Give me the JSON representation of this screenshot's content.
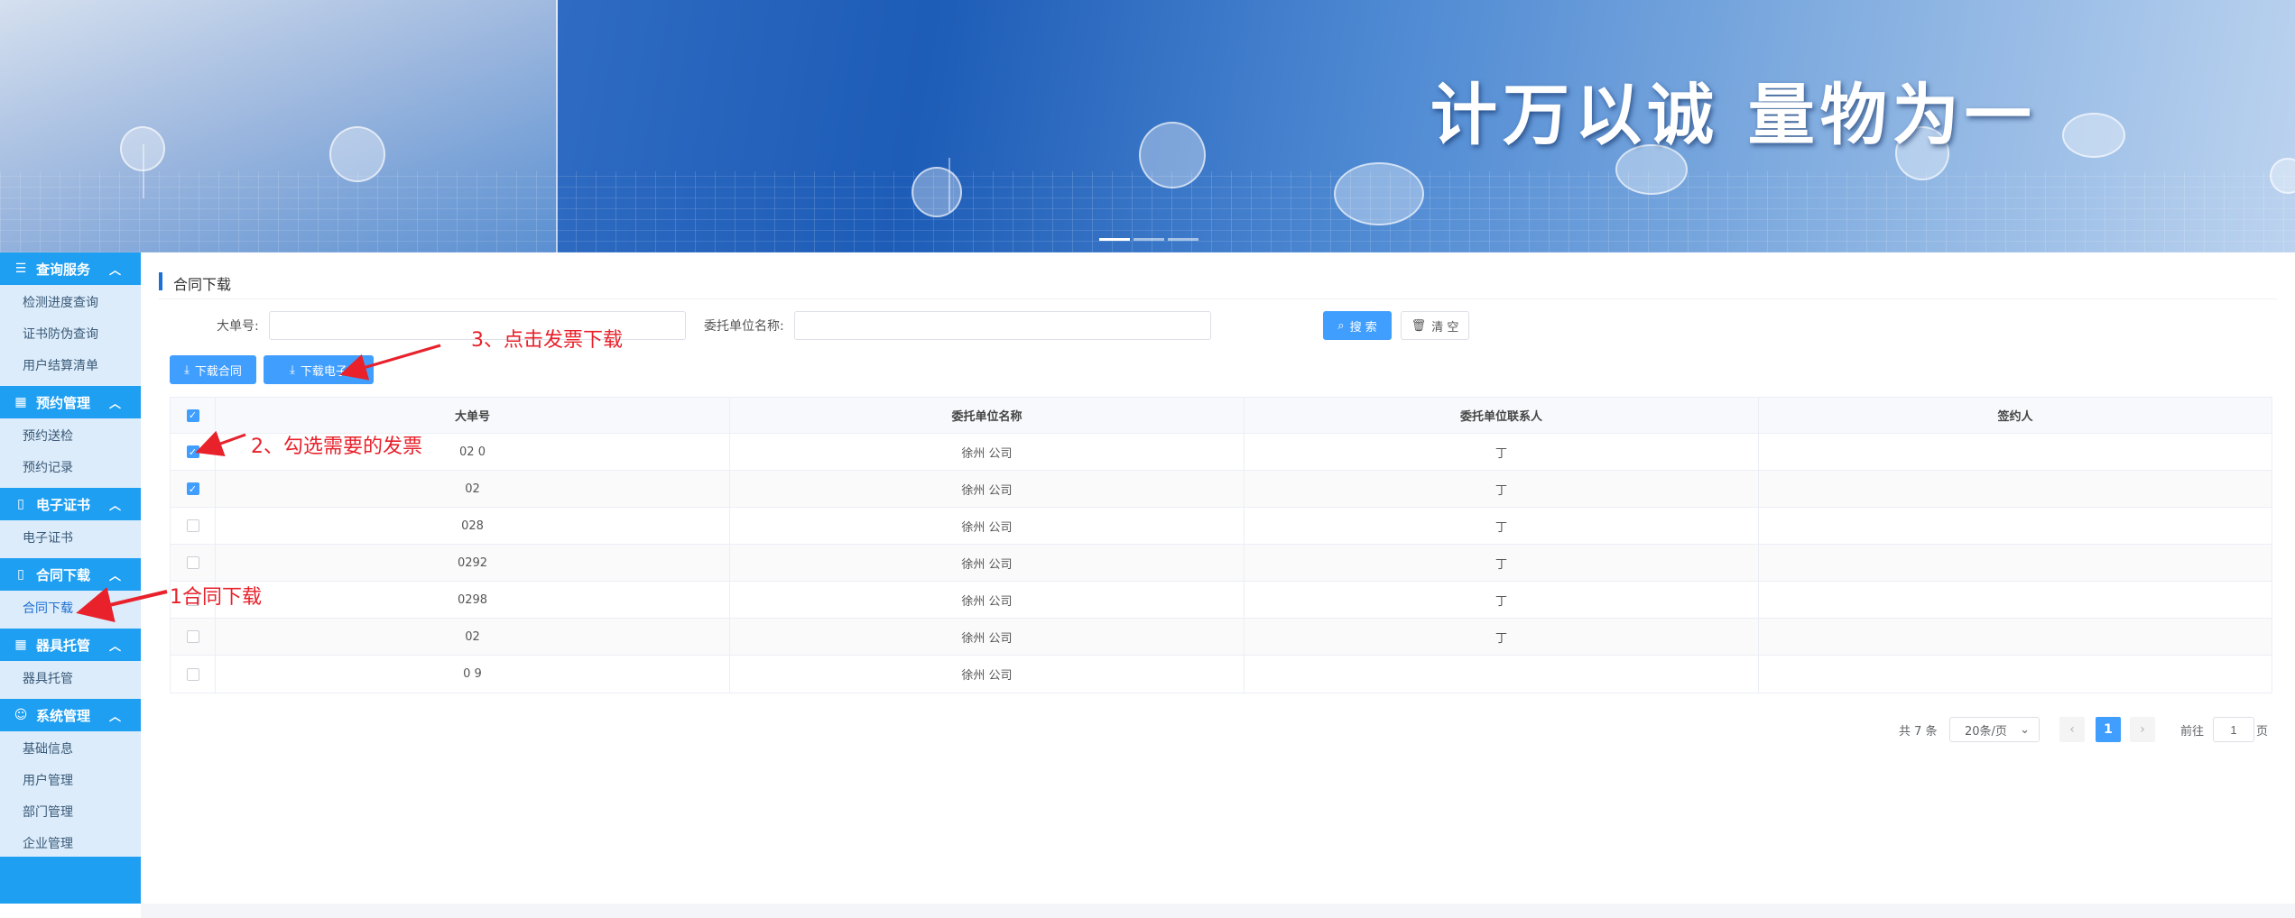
{
  "banner": {
    "slogan": "计万以诚  量物为一"
  },
  "sidebar": {
    "groups": [
      {
        "title": "查询服务",
        "icon": "list-icon",
        "items": [
          "检测进度查询",
          "证书防伪查询",
          "用户结算清单"
        ]
      },
      {
        "title": "预约管理",
        "icon": "calendar-icon",
        "items": [
          "预约送检",
          "预约记录"
        ]
      },
      {
        "title": "电子证书",
        "icon": "document-icon",
        "items": [
          "电子证书"
        ]
      },
      {
        "title": "合同下载",
        "icon": "document-icon",
        "items": [
          "合同下载"
        ]
      },
      {
        "title": "器具托管",
        "icon": "grid-icon",
        "items": [
          "器具托管"
        ]
      },
      {
        "title": "系统管理",
        "icon": "user-icon",
        "items": [
          "基础信息",
          "用户管理",
          "部门管理",
          "企业管理"
        ]
      }
    ]
  },
  "main": {
    "page_title": "合同下载",
    "search": {
      "order_label": "大单号:",
      "order_value": "",
      "unit_label": "委托单位名称:",
      "unit_value": "",
      "search_button": "搜 索",
      "clear_button": "清 空"
    },
    "toolbar": {
      "download_contract": "下载合同",
      "download_invoice": "下载电子"
    },
    "table": {
      "columns": [
        "大单号",
        "委托单位名称",
        "委托单位联系人",
        "签约人"
      ],
      "rows": [
        {
          "checked": true,
          "order": "02 0",
          "unit": "徐州 公司",
          "contact": "丁",
          "signer": ""
        },
        {
          "checked": true,
          "order": "02",
          "unit": "徐州 公司",
          "contact": "丁",
          "signer": ""
        },
        {
          "checked": false,
          "order": "028",
          "unit": "徐州 公司",
          "contact": "丁",
          "signer": ""
        },
        {
          "checked": false,
          "order": "0292",
          "unit": "徐州 公司",
          "contact": "丁",
          "signer": ""
        },
        {
          "checked": false,
          "order": "0298",
          "unit": "徐州 公司",
          "contact": "丁",
          "signer": ""
        },
        {
          "checked": false,
          "order": "02",
          "unit": "徐州 公司",
          "contact": "丁",
          "signer": ""
        },
        {
          "checked": false,
          "order": "0 9",
          "unit": "徐州 公司",
          "contact": "",
          "signer": ""
        }
      ]
    },
    "pagination": {
      "total": "共 7 条",
      "page_size": "20条/页",
      "current_page": "1",
      "goto_label": "前往",
      "goto_value": "1",
      "page_unit": "页"
    }
  },
  "annotations": {
    "step1": "1合同下载",
    "step2": "2、勾选需要的发票",
    "step3": "3、点击发票下载"
  },
  "colors": {
    "primary": "#409eff",
    "sidebar_header": "#1e9ff2",
    "sidebar_bg": "#dcecfa",
    "annotation": "#e8212b"
  }
}
